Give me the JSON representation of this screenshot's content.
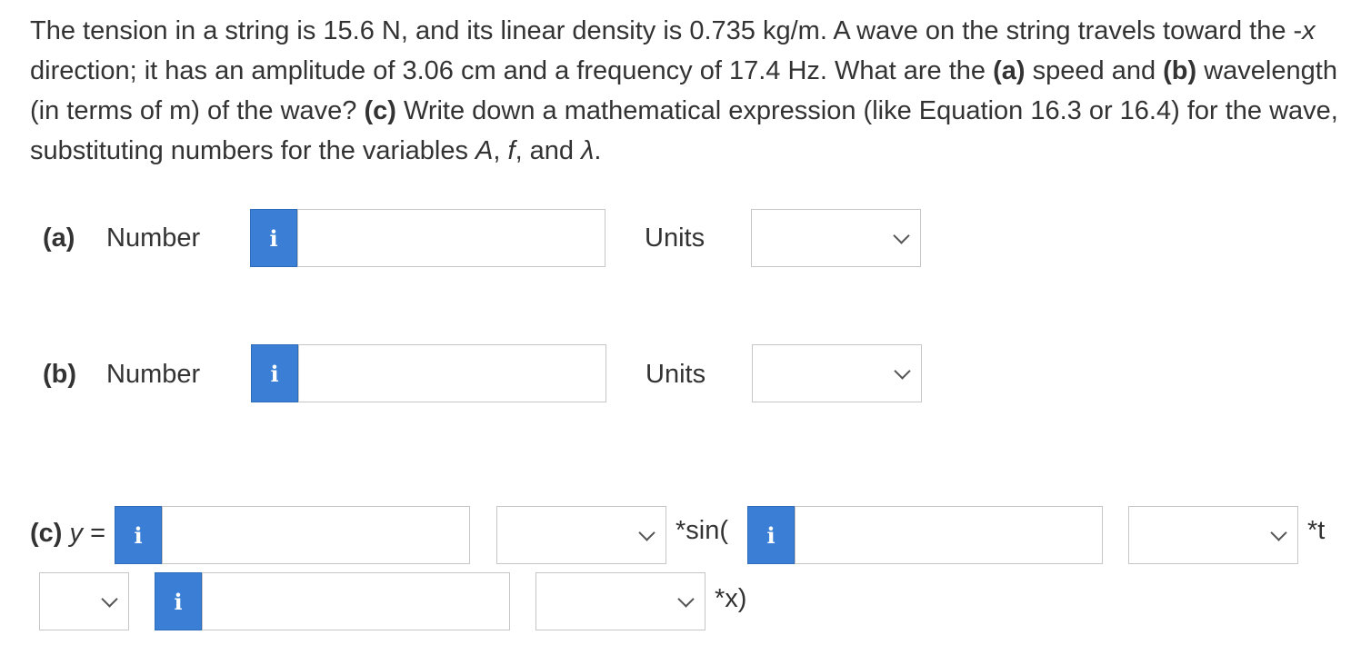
{
  "question": {
    "intro": "The tension in a string is 15.6 N, and its linear density is 0.735 kg/m. A wave on the string travels toward the -",
    "x_var": "x",
    "text2": " direction; it has an amplitude of 3.06 cm and a frequency of 17.4 Hz. What are the ",
    "part_a_tag": "(a)",
    "text3": " speed and ",
    "part_b_tag": "(b)",
    "text4": " wavelength (in terms of m) of the wave? ",
    "part_c_tag": "(c)",
    "text5": " Write down a mathematical expression (like Equation 16.3 or 16.4) for the wave, substituting numbers for the variables ",
    "var_A": "A",
    "comma1": ", ",
    "var_f": "f",
    "and": ", and ",
    "var_lambda": "λ",
    "period": "."
  },
  "part_a": {
    "label": "(a)",
    "number_label": "Number",
    "info": "i",
    "number_value": "",
    "units_label": "Units",
    "units_value": ""
  },
  "part_b": {
    "label": "(b)",
    "number_label": "Number",
    "info": "i",
    "number_value": "",
    "units_label": "Units",
    "units_value": ""
  },
  "part_c": {
    "label": "(c)",
    "y_var": "y",
    "equals": " =",
    "info": "i",
    "amp_value": "",
    "sin_text": "*sin(",
    "omega_value": "",
    "t_text": "*t",
    "k_value": "",
    "x_text": "*x)"
  },
  "colors": {
    "info_button": "#3a7fd5",
    "text": "#333333",
    "border": "#c6c6c6"
  },
  "icons": {
    "info": "info-icon",
    "dropdown": "chevron-down-icon"
  }
}
